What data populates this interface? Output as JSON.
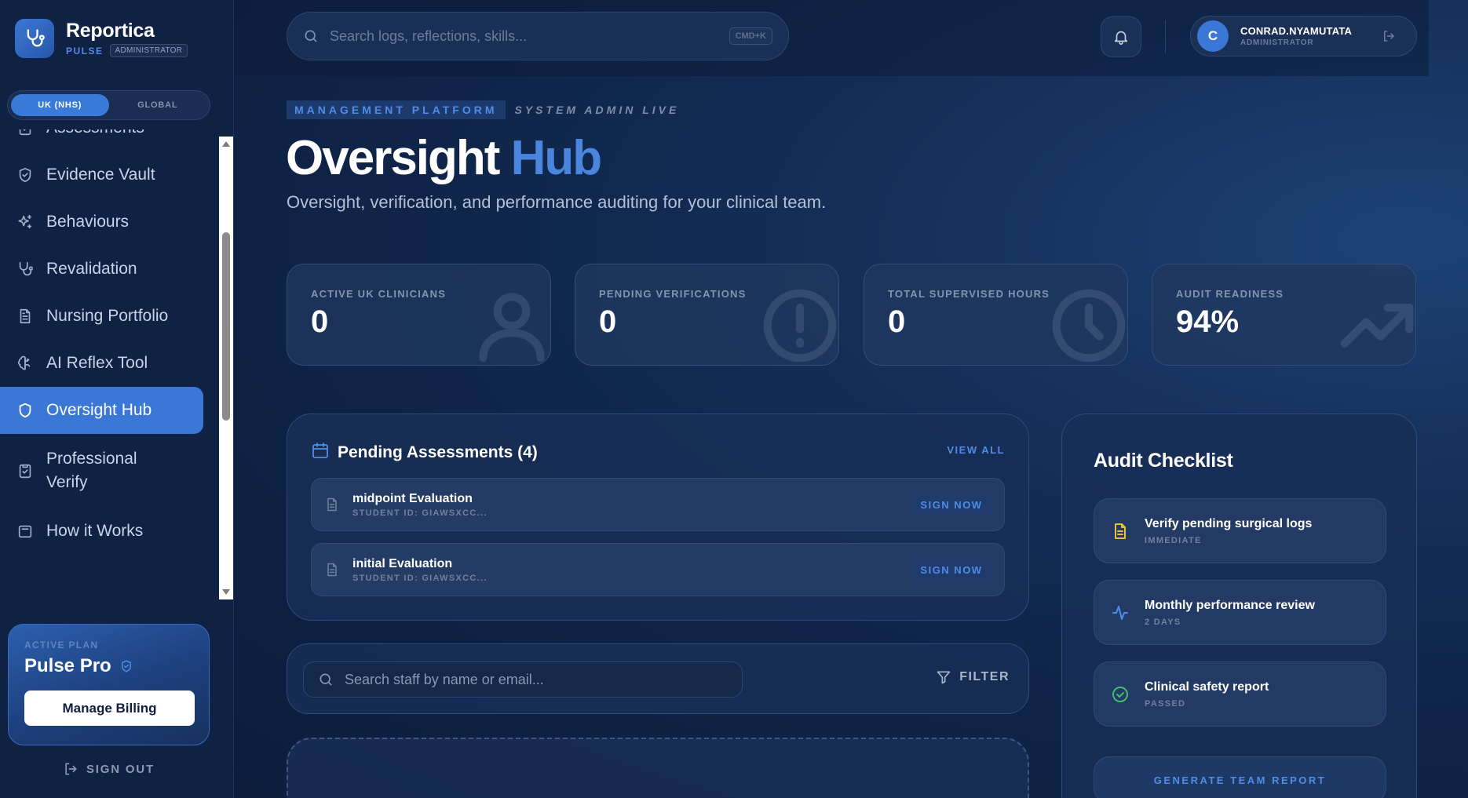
{
  "brand": {
    "name": "Reportica",
    "product": "PULSE",
    "role_badge": "ADMINISTRATOR"
  },
  "region_toggle": {
    "options": [
      "UK (NHS)",
      "GLOBAL"
    ],
    "selected": "UK (NHS)"
  },
  "sidebar": {
    "items": [
      {
        "label": "Assessments",
        "icon": "clipboard-check-icon"
      },
      {
        "label": "Evidence Vault",
        "icon": "shield-icon"
      },
      {
        "label": "Behaviours",
        "icon": "sparkles-icon"
      },
      {
        "label": "Revalidation",
        "icon": "stethoscope-icon"
      },
      {
        "label": "Nursing Portfolio",
        "icon": "document-icon"
      },
      {
        "label": "AI Reflex Tool",
        "icon": "brain-icon"
      },
      {
        "label": "Oversight Hub",
        "icon": "shield-icon",
        "active": true
      },
      {
        "label": "Professional Verify",
        "icon": "clipboard-check-icon"
      },
      {
        "label": "How it Works",
        "icon": "help-icon"
      }
    ]
  },
  "plan": {
    "label": "ACTIVE PLAN",
    "name": "Pulse Pro",
    "billing_button": "Manage Billing"
  },
  "signout_label": "SIGN OUT",
  "header": {
    "search_placeholder": "Search logs, reflections, skills...",
    "search_shortcut": "CMD+K",
    "user": {
      "initial": "C",
      "name": "CONRAD.NYAMUTATA",
      "role": "ADMINISTRATOR"
    }
  },
  "hero": {
    "eyebrow": "MANAGEMENT PLATFORM",
    "eyebrow_status": "SYSTEM ADMIN LIVE",
    "title_main": "Oversight",
    "title_accent": "Hub",
    "subtitle": "Oversight, verification, and performance auditing for your clinical team."
  },
  "stats": [
    {
      "label": "ACTIVE UK CLINICIANS",
      "value": "0",
      "icon": "users-icon"
    },
    {
      "label": "PENDING VERIFICATIONS",
      "value": "0",
      "icon": "alert-circle-icon"
    },
    {
      "label": "TOTAL SUPERVISED HOURS",
      "value": "0",
      "icon": "clock-icon"
    },
    {
      "label": "AUDIT READINESS",
      "value": "94%",
      "icon": "trend-up-icon"
    }
  ],
  "pending": {
    "title": "Pending Assessments (4)",
    "view_all": "VIEW ALL",
    "items": [
      {
        "title": "midpoint Evaluation",
        "subtitle": "STUDENT ID: GIAWSXCC...",
        "action": "SIGN NOW"
      },
      {
        "title": "initial Evaluation",
        "subtitle": "STUDENT ID: GIAWSXCC...",
        "action": "SIGN NOW"
      }
    ]
  },
  "staff": {
    "search_placeholder": "Search staff by name or email...",
    "filter_label": "FILTER"
  },
  "audit": {
    "title": "Audit Checklist",
    "items": [
      {
        "title": "Verify pending surgical logs",
        "status": "IMMEDIATE",
        "icon": "document-icon",
        "color": "#e8c23a"
      },
      {
        "title": "Monthly performance review",
        "status": "2 DAYS",
        "icon": "activity-icon",
        "color": "#4f8ce6"
      },
      {
        "title": "Clinical safety report",
        "status": "PASSED",
        "icon": "check-circle-icon",
        "color": "#3fbf6a"
      }
    ],
    "report_button": "GENERATE TEAM REPORT"
  },
  "colors": {
    "accent": "#3b77d4",
    "accent_text": "#4f8ce6",
    "background": "#0d1f3f"
  }
}
